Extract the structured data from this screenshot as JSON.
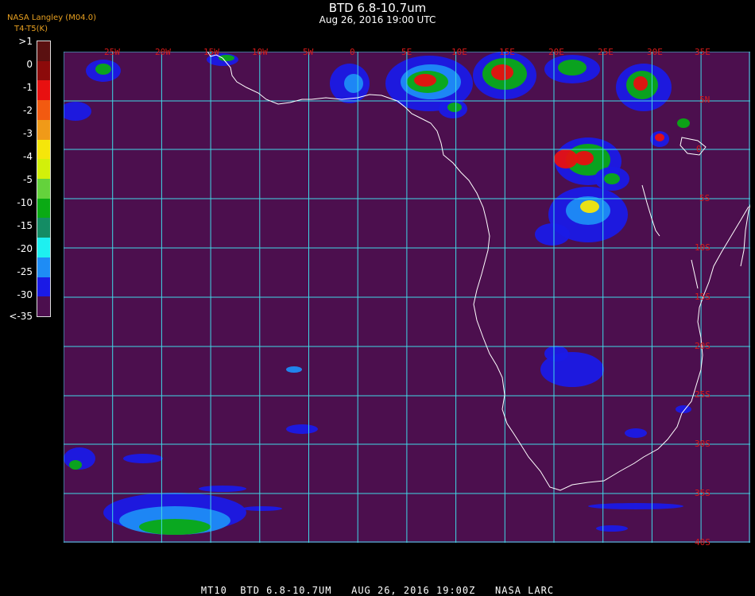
{
  "header": {
    "title": "BTD 6.8-10.7um",
    "subtitle": "Aug 26, 2016 19:00 UTC",
    "agency": "NASA Langley (M04.0)",
    "units": "T4-T5(K)"
  },
  "legend": {
    "labels": [
      ">1",
      "0",
      "-1",
      "-2",
      "-3",
      "-4",
      "-5",
      "-10",
      "-15",
      "-20",
      "-25",
      "-30",
      "<-35"
    ],
    "colors": [
      "#5a1010",
      "#8c0a0a",
      "#e81010",
      "#f25a10",
      "#f09a18",
      "#f5e60a",
      "#d2f00a",
      "#64d23c",
      "#0aaa14",
      "#148c64",
      "#1ef0f0",
      "#1e8cf5",
      "#1a1ae6",
      "#4c0f4e"
    ]
  },
  "map": {
    "lon_labels": [
      "25W",
      "20W",
      "15W",
      "10W",
      "5W",
      "0",
      "5E",
      "10E",
      "15E",
      "20E",
      "25E",
      "30E",
      "35E"
    ],
    "lat_labels": [
      "5N",
      "0",
      "5S",
      "10S",
      "15S",
      "20S",
      "25S",
      "30S",
      "35S",
      "40S"
    ],
    "colors": {
      "background": "#4c0f4e",
      "grid": "#3fd9e6",
      "coast": "#ffffff",
      "label": "#d81a1a"
    }
  },
  "footer": {
    "text": "MT10  BTD 6.8-10.7UM   AUG 26, 2016 19:00Z   NASA LARC"
  }
}
